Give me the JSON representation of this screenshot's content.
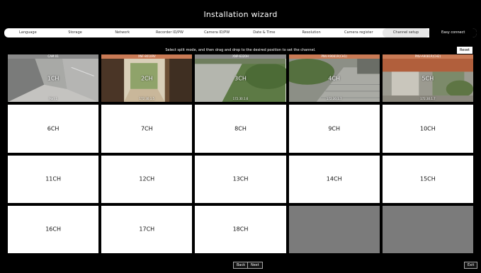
{
  "title": "Installation wizard",
  "steps": [
    "Language",
    "Storage",
    "Network",
    "Recorder ID/PW",
    "Camera ID/PW",
    "Date & Time",
    "Resolution",
    "Camera register",
    "Channel setup",
    "Easy connect"
  ],
  "hint": "Select split mode, and then drag and drop to the desired position to set the channel.",
  "reset_label": "Reset",
  "cameras": [
    {
      "bar": "CAM 01",
      "ch": "1CH",
      "sub": "Port 1",
      "bar_color": "#8a8a8a"
    },
    {
      "bar": "XNF-8010RV",
      "ch": "2CH",
      "sub": "172.30.1.5",
      "bar_color": "#c97a55"
    },
    {
      "bar": "XNP-6320H",
      "ch": "3CH",
      "sub": "172.30.1.6",
      "bar_color": "#8a8a8a"
    },
    {
      "bar": "PNV-A9081R(CH1)",
      "ch": "4CH",
      "sub": "172.30.1.7",
      "bar_color": "#c97a55"
    },
    {
      "bar": "PNV-A9081R(CH2)",
      "ch": "5CH",
      "sub": "172.30.1.7",
      "bar_color": "#c97a55"
    }
  ],
  "channels": [
    "6CH",
    "7CH",
    "8CH",
    "9CH",
    "10CH",
    "11CH",
    "12CH",
    "13CH",
    "14CH",
    "15CH",
    "16CH",
    "17CH",
    "18CH"
  ],
  "back_label": "Back",
  "next_label": "Next",
  "exit_label": "Exit"
}
